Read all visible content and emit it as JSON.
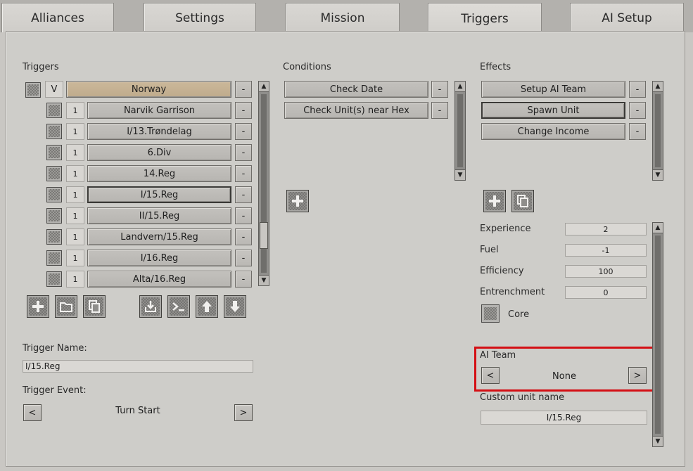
{
  "tabs": [
    {
      "label": "Alliances",
      "active": false
    },
    {
      "label": "Settings",
      "active": false
    },
    {
      "label": "Mission",
      "active": false
    },
    {
      "label": "Triggers",
      "active": true
    },
    {
      "label": "AI Setup",
      "active": false
    }
  ],
  "triggers": {
    "label": "Triggers",
    "header": {
      "flag": "V",
      "name": "Norway",
      "remove": "-"
    },
    "rows": [
      {
        "count": "1",
        "name": "Narvik Garrison",
        "remove": "-"
      },
      {
        "count": "1",
        "name": "I/13.Trøndelag",
        "remove": "-"
      },
      {
        "count": "1",
        "name": "6.Div",
        "remove": "-"
      },
      {
        "count": "1",
        "name": "14.Reg",
        "remove": "-"
      },
      {
        "count": "1",
        "name": "I/15.Reg",
        "remove": "-"
      },
      {
        "count": "1",
        "name": "II/15.Reg",
        "remove": "-"
      },
      {
        "count": "1",
        "name": "Landvern/15.Reg",
        "remove": "-"
      },
      {
        "count": "1",
        "name": "I/16.Reg",
        "remove": "-"
      },
      {
        "count": "1",
        "name": "Alta/16.Reg",
        "remove": "-"
      }
    ],
    "name_label": "Trigger Name:",
    "name_value": "I/15.Reg",
    "event_label": "Trigger Event:",
    "event_value": "Turn Start",
    "prev": "<",
    "next": ">"
  },
  "conditions": {
    "label": "Conditions",
    "items": [
      {
        "name": "Check Date",
        "remove": "-"
      },
      {
        "name": "Check Unit(s) near Hex",
        "remove": "-"
      }
    ]
  },
  "effects": {
    "label": "Effects",
    "items": [
      {
        "name": "Setup AI Team",
        "remove": "-"
      },
      {
        "name": "Spawn Unit",
        "remove": "-"
      },
      {
        "name": "Change Income",
        "remove": "-"
      }
    ],
    "props": [
      {
        "label": "Experience",
        "value": "2"
      },
      {
        "label": "Fuel",
        "value": "-1"
      },
      {
        "label": "Efficiency",
        "value": "100"
      },
      {
        "label": "Entrenchment",
        "value": "0"
      }
    ],
    "core_label": "Core",
    "ai_team_label": "AI Team",
    "ai_team_value": "None",
    "prev": "<",
    "next": ">",
    "custom_label": "Custom unit name",
    "custom_value": "I/15.Reg"
  },
  "colors": {
    "highlight": "#d40f14",
    "norway": "#c4b091"
  }
}
